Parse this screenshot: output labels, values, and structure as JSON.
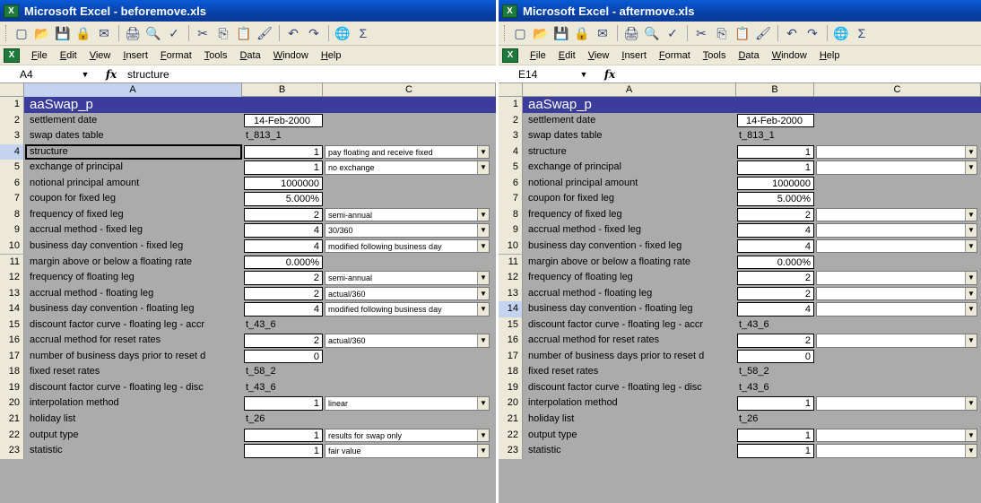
{
  "left": {
    "title": "Microsoft Excel - beforemove.xls",
    "name_box": "A4",
    "formula": "structure",
    "active_cell": "4",
    "show_dropdown_text": true
  },
  "right": {
    "title": "Microsoft Excel - aftermove.xls",
    "name_box": "E14",
    "formula": "",
    "active_cell": "14",
    "show_dropdown_text": false
  },
  "menu": [
    "File",
    "Edit",
    "View",
    "Insert",
    "Format",
    "Tools",
    "Data",
    "Window",
    "Help"
  ],
  "columns": [
    "A",
    "B",
    "C"
  ],
  "fx_label": "fx",
  "rows": [
    {
      "n": "1",
      "a": "aaSwap_p",
      "b": "",
      "c": "",
      "kind": "title"
    },
    {
      "n": "2",
      "a": "settlement date",
      "b": "14-Feb-2000",
      "c": "",
      "kind": "date"
    },
    {
      "n": "3",
      "a": "swap dates table",
      "b": "t_813_1",
      "c": "",
      "kind": "plain"
    },
    {
      "n": "4",
      "a": "structure",
      "b": "1",
      "c": "pay floating and receive fixed",
      "kind": "dd"
    },
    {
      "n": "5",
      "a": "exchange of principal",
      "b": "1",
      "c": "no exchange",
      "kind": "dd"
    },
    {
      "n": "6",
      "a": "notional principal amount",
      "b": "1000000",
      "c": "",
      "kind": "box"
    },
    {
      "n": "7",
      "a": "coupon for fixed leg",
      "b": "5.000%",
      "c": "",
      "kind": "box"
    },
    {
      "n": "8",
      "a": "frequency of fixed leg",
      "b": "2",
      "c": "semi-annual",
      "kind": "dd"
    },
    {
      "n": "9",
      "a": "accrual method - fixed leg",
      "b": "4",
      "c": "30/360",
      "kind": "dd"
    },
    {
      "n": "10",
      "a": "business day convention - fixed leg",
      "b": "4",
      "c": "modified following business day",
      "kind": "dd"
    },
    {
      "n": "11",
      "a": "margin above or below a floating rate",
      "b": "0.000%",
      "c": "",
      "kind": "box"
    },
    {
      "n": "12",
      "a": "frequency of floating leg",
      "b": "2",
      "c": "semi-annual",
      "kind": "dd"
    },
    {
      "n": "13",
      "a": "accrual method - floating leg",
      "b": "2",
      "c": "actual/360",
      "kind": "dd"
    },
    {
      "n": "14",
      "a": "business day convention - floating leg",
      "b": "4",
      "c": "modified following business day",
      "kind": "dd"
    },
    {
      "n": "15",
      "a": "discount factor curve - floating leg - accr",
      "b": "t_43_6",
      "c": "",
      "kind": "plain"
    },
    {
      "n": "16",
      "a": "accrual method for reset rates",
      "b": "2",
      "c": "actual/360",
      "kind": "dd"
    },
    {
      "n": "17",
      "a": "number of business days prior to reset d",
      "b": "0",
      "c": "",
      "kind": "box"
    },
    {
      "n": "18",
      "a": "fixed reset rates",
      "b": "t_58_2",
      "c": "",
      "kind": "plain"
    },
    {
      "n": "19",
      "a": "discount factor curve - floating leg - disc",
      "b": "t_43_6",
      "c": "",
      "kind": "plain"
    },
    {
      "n": "20",
      "a": "interpolation method",
      "b": "1",
      "c": "linear",
      "kind": "dd"
    },
    {
      "n": "21",
      "a": "holiday list",
      "b": "t_26",
      "c": "",
      "kind": "plain"
    },
    {
      "n": "22",
      "a": "output type",
      "b": "1",
      "c": "results for swap only",
      "kind": "dd"
    },
    {
      "n": "23",
      "a": "statistic",
      "b": "1",
      "c": "fair value",
      "kind": "dd"
    }
  ]
}
